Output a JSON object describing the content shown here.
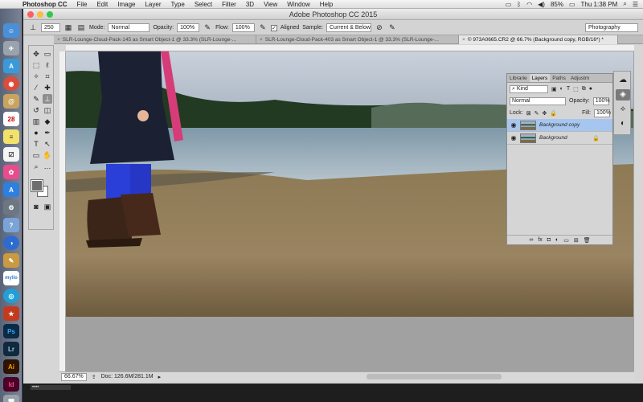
{
  "menubar": {
    "app_name": "Photoshop CC",
    "items": [
      "File",
      "Edit",
      "Image",
      "Layer",
      "Type",
      "Select",
      "Filter",
      "3D",
      "View",
      "Window",
      "Help"
    ],
    "battery": "85%",
    "clock": "Thu 1:38 PM"
  },
  "window": {
    "title": "Adobe Photoshop CC 2015"
  },
  "options_bar": {
    "brush_size": "250",
    "mode_label": "Mode:",
    "mode_value": "Normal",
    "opacity_label": "Opacity:",
    "opacity_value": "100%",
    "flow_label": "Flow:",
    "flow_value": "100%",
    "aligned_label": "Aligned",
    "sample_label": "Sample:",
    "sample_value": "Current & Below",
    "workspace": "Photography"
  },
  "tabs": [
    {
      "label": "SLR-Lounge-Cloud-Pack-145 as Smart Object-1 @ 33.3% (SLR-Lounge-..."
    },
    {
      "label": "SLR-Lounge-Cloud-Pack-403 as Smart Object-1 @ 33.3% (SLR-Lounge-..."
    },
    {
      "label": "© 973A0665.CR2 @ 66.7% (Background copy, RGB/16*) *"
    }
  ],
  "status_bar": {
    "zoom": "66.67%",
    "doc_info": "Doc: 126.6M/281.1M"
  },
  "layers_panel": {
    "tabs": [
      "Librarie",
      "Layers",
      "Paths",
      "Adjustm"
    ],
    "filter_kind": "Kind",
    "blend_mode": "Normal",
    "opacity_label": "Opacity:",
    "opacity_value": "100%",
    "lock_label": "Lock:",
    "fill_label": "Fill:",
    "fill_value": "100%",
    "layers": [
      {
        "name": "Background copy"
      },
      {
        "name": "Background"
      }
    ]
  },
  "colors": {
    "menubar": "#e8e8e8",
    "panel": "#d6d6d6",
    "active_layer": "#a7c6ef",
    "canvas_bg": "#a1a1a1"
  }
}
